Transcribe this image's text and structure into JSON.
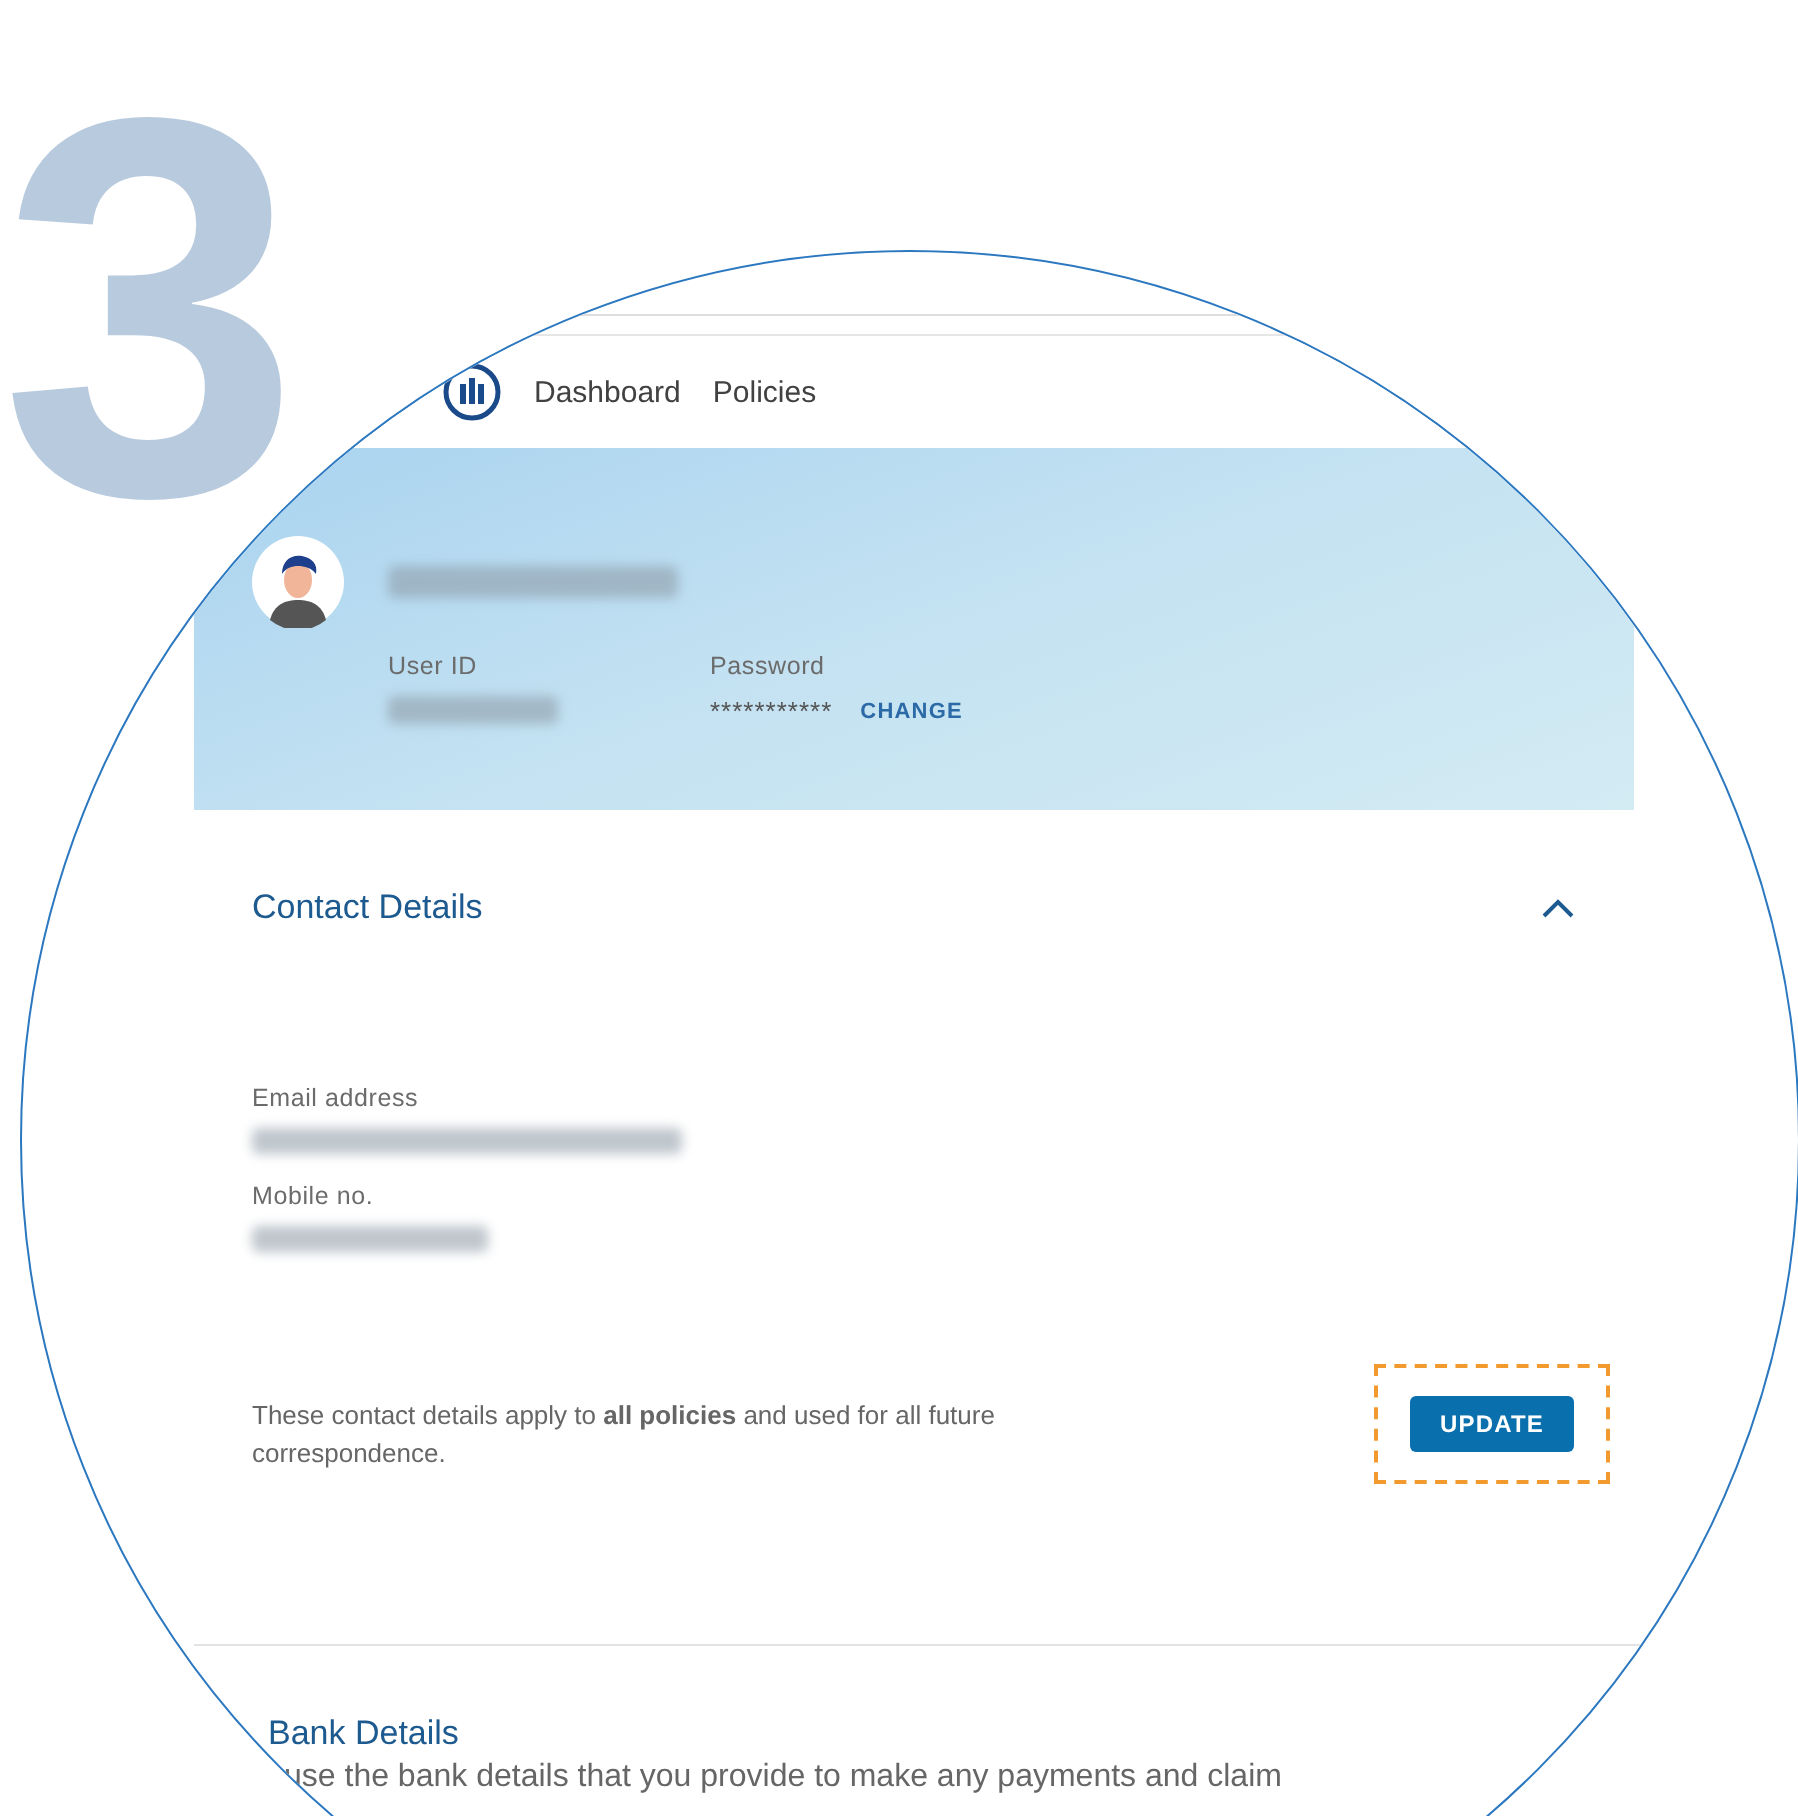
{
  "step_number": "3",
  "nav": {
    "items": [
      {
        "label": "Dashboard"
      },
      {
        "label": "Policies"
      }
    ]
  },
  "profile": {
    "user_id_label": "User ID",
    "password_label": "Password",
    "password_value": "***********",
    "change_link": "CHANGE"
  },
  "contact": {
    "title": "Contact Details",
    "expanded": true,
    "fields": [
      {
        "label": "Email address"
      },
      {
        "label": "Mobile no."
      }
    ],
    "note": "These contact details apply to **all policies** and used for all future correspondence.",
    "button": "UPDATE"
  },
  "bank": {
    "title": "Bank Details",
    "description": "use the bank details that you provide to make any payments and claim"
  }
}
